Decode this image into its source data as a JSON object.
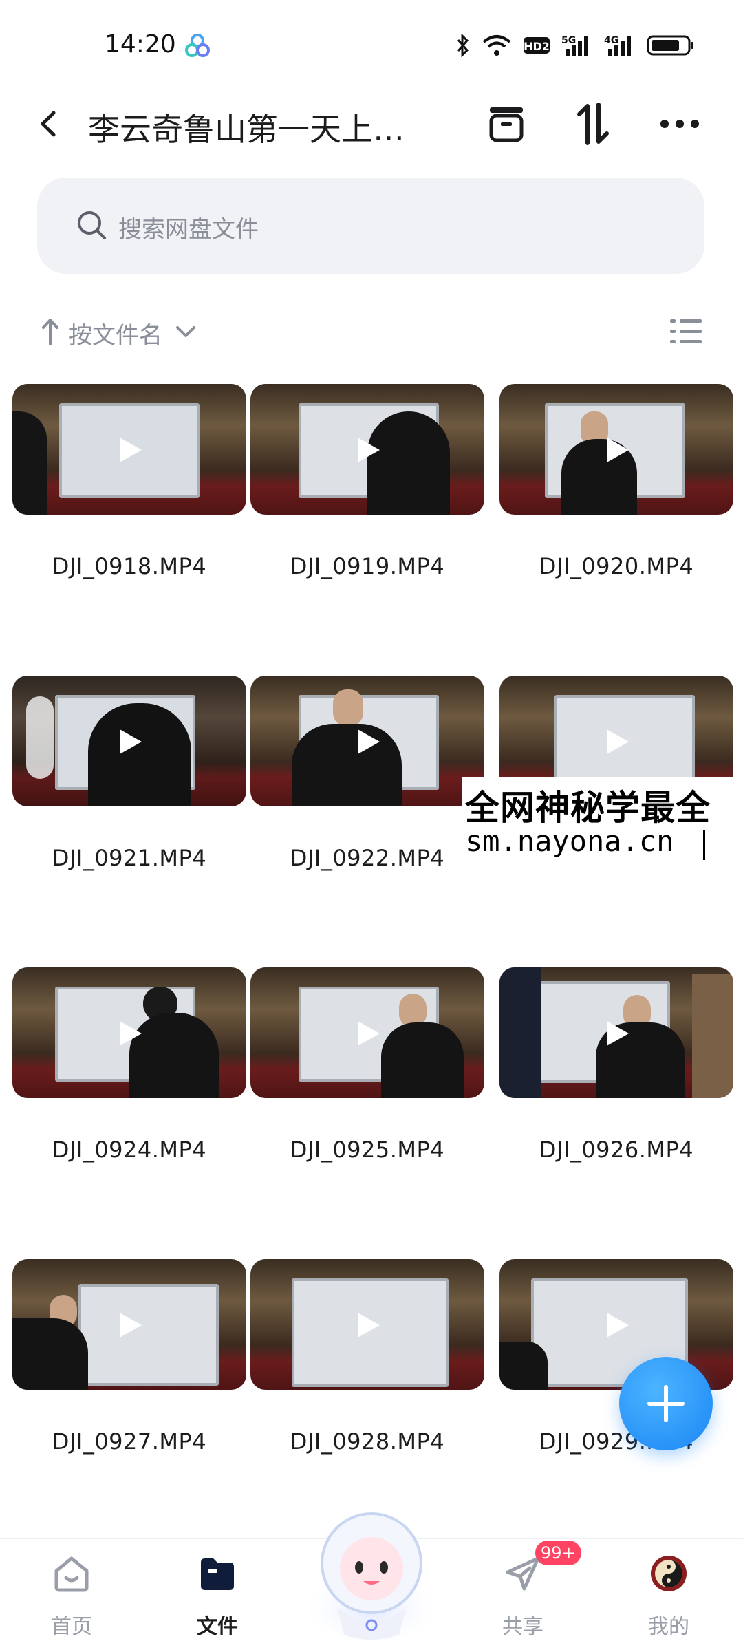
{
  "status_bar": {
    "time": "14:20",
    "icons": [
      "app-icon",
      "bluetooth-icon",
      "wifi-icon",
      "hd-icon",
      "signal-icon",
      "signal-icon",
      "battery-icon"
    ],
    "network_labels": [
      "HD2",
      "5G",
      "4G"
    ]
  },
  "header": {
    "title": "李云奇鲁山第一天上…",
    "icons": [
      "back-icon",
      "bin-icon",
      "transfer-icon",
      "more-icon"
    ]
  },
  "search": {
    "placeholder": "搜索网盘文件"
  },
  "sort": {
    "label": "按文件名"
  },
  "files": [
    {
      "name": "DJI_0918.MP4"
    },
    {
      "name": "DJI_0919.MP4"
    },
    {
      "name": "DJI_0920.MP4"
    },
    {
      "name": "DJI_0921.MP4"
    },
    {
      "name": "DJI_0922.MP4"
    },
    {
      "name": ""
    },
    {
      "name": "DJI_0924.MP4"
    },
    {
      "name": "DJI_0925.MP4"
    },
    {
      "name": "DJI_0926.MP4"
    },
    {
      "name": "DJI_0927.MP4"
    },
    {
      "name": "DJI_0928.MP4"
    },
    {
      "name": "DJI_0929.MP4"
    }
  ],
  "watermark": {
    "line1": "全网神秘学最全",
    "line2": "sm.nayona.cn"
  },
  "bottom_nav": {
    "items": [
      {
        "label": "首页",
        "icon": "home-icon",
        "active": false
      },
      {
        "label": "文件",
        "icon": "folder-icon",
        "active": true
      },
      {
        "label": "共享",
        "icon": "share-icon",
        "active": false,
        "badge": "99+"
      },
      {
        "label": "我的",
        "icon": "avatar-icon",
        "active": false
      }
    ]
  },
  "colors": {
    "accent": "#1a86f5",
    "badge": "#ff4463",
    "search_bg": "#f1f2f6",
    "muted_text": "#8a8e99"
  }
}
